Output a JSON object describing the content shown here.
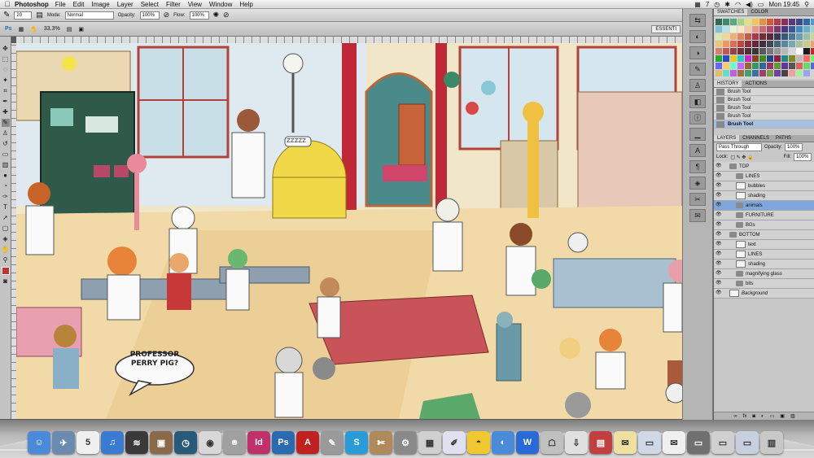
{
  "menubar": {
    "app": "Photoshop",
    "menus": [
      "File",
      "Edit",
      "Image",
      "Layer",
      "Select",
      "Filter",
      "View",
      "Window",
      "Help"
    ],
    "clock": "Mon 19:45",
    "status_num": "7"
  },
  "options_bar": {
    "brush_size": "20",
    "mode_label": "Mode:",
    "mode_value": "Normal",
    "opacity_label": "Opacity:",
    "opacity_value": "100%",
    "flow_label": "Flow:",
    "flow_value": "100%"
  },
  "app_bar": {
    "ps": "Ps",
    "zoom": "33.3%",
    "essentials": "ESSENTI"
  },
  "artwork": {
    "speech_line1": "PROFESSOR",
    "speech_line2": "PERRY PIG?",
    "zzz": "ZZZZZ"
  },
  "swatches_panel": {
    "tabs": [
      "SWATCHES",
      "COLOR"
    ],
    "colors": [
      "#2f6b5a",
      "#3d8a6e",
      "#5aa87d",
      "#a8d08a",
      "#e3e08a",
      "#f2c45b",
      "#e8913d",
      "#d45a3a",
      "#b83a4a",
      "#8a2f5a",
      "#5a3a7a",
      "#3a4a8a",
      "#2f6aa8",
      "#4aa0c8",
      "#7fc0d8",
      "#b8e0e8",
      "#e8f0d8",
      "#f8e8c8",
      "#f0c8a8",
      "#e09888",
      "#c86878",
      "#a84868",
      "#7a3868",
      "#4a3878",
      "#385898",
      "#4888b8",
      "#68b0c8",
      "#a0d0d0",
      "#d8e8b0",
      "#f0d890",
      "#f0b070",
      "#e08858",
      "#c85848",
      "#a83848",
      "#782838",
      "#582838",
      "#383858",
      "#385878",
      "#487898",
      "#68a0b0",
      "#98c0a8",
      "#c8d898",
      "#e8c878",
      "#e89868",
      "#d87058",
      "#b84848",
      "#883038",
      "#602838",
      "#403040",
      "#404858",
      "#486878",
      "#5888a0",
      "#78a8b0",
      "#a8c0a0",
      "#d0c888",
      "#e0a878",
      "#d88068",
      "#c05858",
      "#984048",
      "#703038",
      "#503038",
      "#383838",
      "#585858",
      "#787878",
      "#989898",
      "#b8b8b8",
      "#d8d8d8",
      "#f8f8f8",
      "#1a1a1a",
      "#c82828",
      "#28a828",
      "#2848c8",
      "#e8c828",
      "#28c8c8",
      "#c828c8",
      "#884422",
      "#448822",
      "#224488",
      "#882244",
      "#228888",
      "#888822",
      "#bbbbbb",
      "#ff6666",
      "#66ff66",
      "#6666ff",
      "#ffcc66",
      "#66ffcc",
      "#cc66ff",
      "#996633",
      "#339966",
      "#336699",
      "#993366",
      "#669933",
      "#663399",
      "#555555",
      "#e06060",
      "#60e060",
      "#6060e0",
      "#e0c060",
      "#60e0c0",
      "#c060e0",
      "#a07040",
      "#40a070",
      "#4070a0",
      "#a04070",
      "#70a040",
      "#7040a0",
      "#444444",
      "#f0a0a0",
      "#a0f0a0",
      "#a0a0f0"
    ]
  },
  "history_panel": {
    "tabs": [
      "HISTORY",
      "ACTIONS"
    ],
    "items": [
      "Brush Tool",
      "Brush Tool",
      "Brush Tool",
      "Brush Tool",
      "Brush Tool"
    ]
  },
  "layers_panel": {
    "tabs": [
      "LAYERS",
      "CHANNELS",
      "PATHS"
    ],
    "blend": "Pass Through",
    "opacity_label": "Opacity:",
    "opacity_value": "100%",
    "lock_label": "Lock:",
    "fill_label": "Fill:",
    "fill_value": "100%",
    "layers": [
      {
        "name": "TOP",
        "indent": 0,
        "kind": "group",
        "selected": false
      },
      {
        "name": "LINES",
        "indent": 1,
        "kind": "group",
        "selected": false
      },
      {
        "name": "bubbles",
        "indent": 1,
        "kind": "layer",
        "selected": false
      },
      {
        "name": "shading",
        "indent": 1,
        "kind": "layer",
        "selected": false
      },
      {
        "name": "animals",
        "indent": 1,
        "kind": "group",
        "selected": true
      },
      {
        "name": "FURNITURE",
        "indent": 1,
        "kind": "group",
        "selected": false
      },
      {
        "name": "BGs",
        "indent": 1,
        "kind": "group",
        "selected": false
      },
      {
        "name": "BOTTOM",
        "indent": 0,
        "kind": "group",
        "selected": false
      },
      {
        "name": "text",
        "indent": 1,
        "kind": "layer",
        "selected": false
      },
      {
        "name": "LINES",
        "indent": 1,
        "kind": "layer",
        "selected": false
      },
      {
        "name": "shading",
        "indent": 1,
        "kind": "layer",
        "selected": false
      },
      {
        "name": "magnifying glass",
        "indent": 1,
        "kind": "group",
        "selected": false
      },
      {
        "name": "bits",
        "indent": 1,
        "kind": "group",
        "selected": false
      },
      {
        "name": "Background",
        "indent": 0,
        "kind": "layer",
        "selected": false
      }
    ]
  },
  "dock": {
    "items": [
      {
        "name": "finder",
        "color": "#4a8ad8",
        "glyph": "☺"
      },
      {
        "name": "preview",
        "color": "#6a8ab0",
        "glyph": "✈"
      },
      {
        "name": "ical",
        "color": "#f0f0f0",
        "glyph": "5"
      },
      {
        "name": "itunes",
        "color": "#3a7ad0",
        "glyph": "♫"
      },
      {
        "name": "spotify",
        "color": "#3a3a3a",
        "glyph": "≋"
      },
      {
        "name": "iphoto",
        "color": "#8a6a4a",
        "glyph": "▣"
      },
      {
        "name": "time-machine",
        "color": "#2a5a7a",
        "glyph": "◷"
      },
      {
        "name": "chrome",
        "color": "#d8d8d8",
        "glyph": "◉"
      },
      {
        "name": "photo-booth",
        "color": "#a0a0a0",
        "glyph": "☻"
      },
      {
        "name": "indesign",
        "color": "#c0306a",
        "glyph": "Id"
      },
      {
        "name": "photoshop",
        "color": "#2a6ab0",
        "glyph": "Ps"
      },
      {
        "name": "acrobat",
        "color": "#c02020",
        "glyph": "A"
      },
      {
        "name": "pen",
        "color": "#9a9a9a",
        "glyph": "✎"
      },
      {
        "name": "skype",
        "color": "#2a9ad8",
        "glyph": "S"
      },
      {
        "name": "utilities",
        "color": "#b08a5a",
        "glyph": "✄"
      },
      {
        "name": "system-prefs",
        "color": "#8a8a8a",
        "glyph": "⚙"
      },
      {
        "name": "calculator",
        "color": "#d0d0d0",
        "glyph": "▦"
      },
      {
        "name": "textedit",
        "color": "#e0e0f0",
        "glyph": "✐"
      },
      {
        "name": "cyberduck",
        "color": "#f0c830",
        "glyph": "◓"
      },
      {
        "name": "dashboard",
        "color": "#4a8ad8",
        "glyph": "◐"
      },
      {
        "name": "word",
        "color": "#2a6ad8",
        "glyph": "W"
      },
      {
        "name": "automator",
        "color": "#c0c0c0",
        "glyph": "☖"
      },
      {
        "name": "downloads",
        "color": "#e0e0e0",
        "glyph": "⇩"
      },
      {
        "name": "photos-stack",
        "color": "#c04040",
        "glyph": "▤"
      },
      {
        "name": "notes",
        "color": "#f0e0a0",
        "glyph": "✉"
      },
      {
        "name": "documents",
        "color": "#d0d8e8",
        "glyph": "▭"
      },
      {
        "name": "mail",
        "color": "#f0f0f0",
        "glyph": "✉"
      },
      {
        "name": "window-1",
        "color": "#707070",
        "glyph": "▭"
      },
      {
        "name": "window-2",
        "color": "#d0d0d0",
        "glyph": "▭"
      },
      {
        "name": "window-3",
        "color": "#c8d0e0",
        "glyph": "▭"
      },
      {
        "name": "trash",
        "color": "#c8c8c8",
        "glyph": "▥"
      }
    ]
  }
}
